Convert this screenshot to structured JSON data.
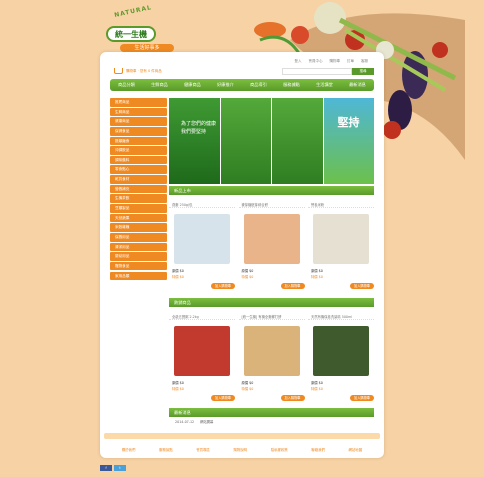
{
  "logo": {
    "arc_text": "NATURAL",
    "main": "統一生機",
    "sub": "生活好事多"
  },
  "toplinks": [
    "登入",
    "會員中心",
    "購物車",
    "訂單",
    "客服"
  ],
  "search": {
    "placeholder": "",
    "button": "搜尋"
  },
  "cart": {
    "label": "購物車 · 您有 0 件商品"
  },
  "nav": [
    "商品分類",
    "生鮮商品",
    "健康商品",
    "好康推介",
    "商品導引",
    "服務據點",
    "生活講堂",
    "最新消息"
  ],
  "sidebar": [
    "推薦商品",
    "生鮮商品",
    "健康商品",
    "保健食品",
    "穀類麵食",
    "沖調飲品",
    "調味醬料",
    "零食點心",
    "乾貨食材",
    "營養補充",
    "生機茶飲",
    "豆類製品",
    "天然蔬果",
    "米穀雜糧",
    "保養用品",
    "清潔用品",
    "嬰幼用品",
    "寵物食品",
    "家用品類"
  ],
  "banner": {
    "panel1": "為了您們的健康\n我們要堅持",
    "panel4": "堅持"
  },
  "section_new": "新品上市",
  "products_new": [
    {
      "name": "燕麥 250g/包",
      "price": "原價 $0",
      "sale": "特價 $0",
      "btn": "加入購物車"
    },
    {
      "name": "麥芽糖胚芽綜合餅",
      "price": "原價 $0",
      "sale": "特價 $0",
      "btn": "加入購物車"
    },
    {
      "name": "營養米粉",
      "price": "原價 $0",
      "sale": "特價 $0",
      "btn": "加入購物車"
    }
  ],
  "section_hot": "熱銷商品",
  "products_hot": [
    {
      "name": "全穀五寶粥 2.2kg",
      "price": "原價 $0",
      "sale": "特價 $0",
      "btn": "加入購物車"
    },
    {
      "name": "[統一生機] 有機全麥蘇打餅",
      "price": "原價 $0",
      "sale": "特價 $0",
      "btn": "加入購物車"
    },
    {
      "name": "天然有機保養洗髮精 500ml",
      "price": "原價 $0",
      "sale": "特價 $0",
      "btn": "加入購物車"
    }
  ],
  "section_news": "最新消息",
  "news": {
    "date": "2014-07-12",
    "title": "網站開幕"
  },
  "footer": [
    "關於我們",
    "服務據點",
    "會員專區",
    "購物說明",
    "隱私權政策",
    "聯絡我們",
    "網站地圖"
  ],
  "share": [
    "f",
    "t"
  ]
}
